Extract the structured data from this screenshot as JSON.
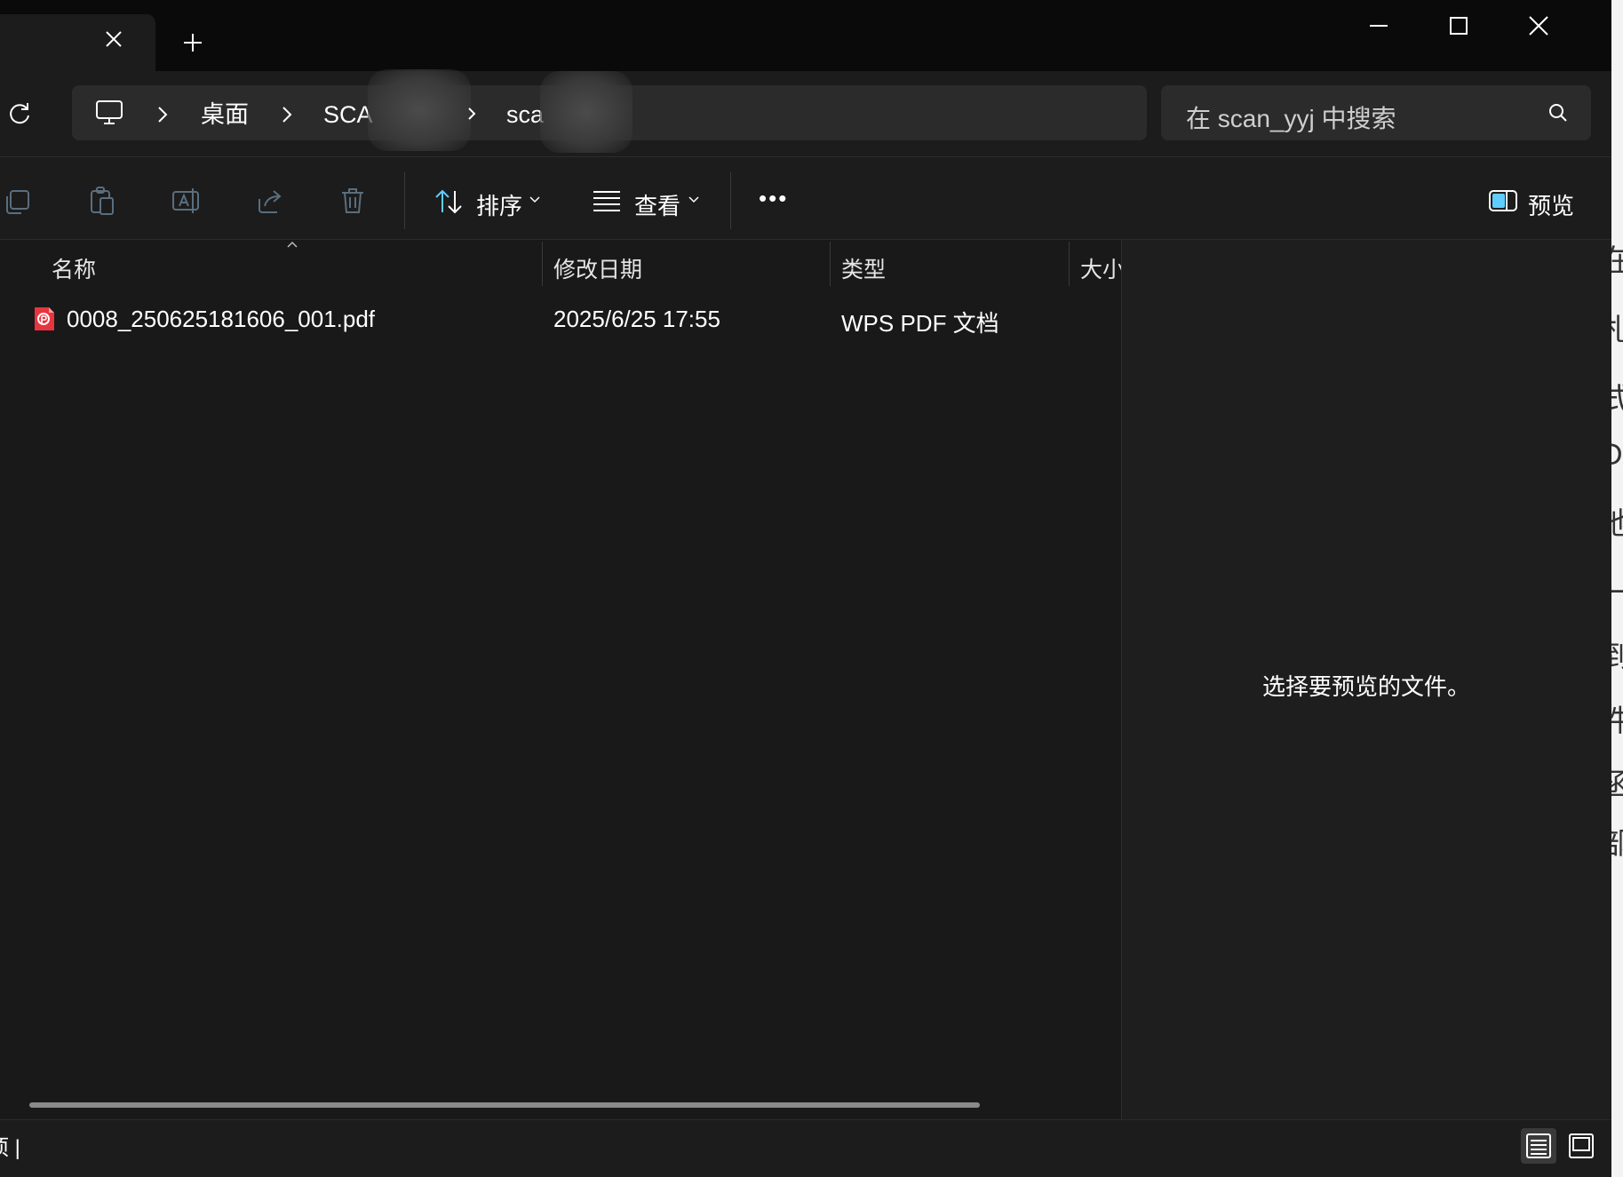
{
  "titlebar": {
    "tab_close_icon": "close-icon",
    "new_tab_icon": "plus-icon",
    "window_controls": [
      "minimize-icon",
      "maximize-icon",
      "close-icon"
    ]
  },
  "address": {
    "refresh_icon": "refresh-icon",
    "computer_icon": "computer-icon",
    "breadcrumbs": [
      "桌面",
      "SCA",
      "sca"
    ]
  },
  "search": {
    "placeholder": "在 scan_yyj 中搜索",
    "icon": "search-icon"
  },
  "toolbar": {
    "sort_label": "排序",
    "view_label": "查看",
    "more_label": "•••",
    "preview_label": "预览"
  },
  "columns": {
    "name": "名称",
    "date": "修改日期",
    "type": "类型",
    "size": "大小"
  },
  "files": [
    {
      "name": "0008_250625181606_001.pdf",
      "date": "2025/6/25 17:55",
      "type": "WPS PDF 文档",
      "size": "",
      "icon": "pdf-file-icon"
    }
  ],
  "preview_pane": {
    "message": "选择要预览的文件。"
  },
  "statusbar": {
    "text": "项 |"
  },
  "background_window": {
    "glyphs": [
      "在",
      "札",
      "式",
      "DF",
      "他",
      "一",
      "到",
      "件",
      "函",
      "部"
    ]
  },
  "colors": {
    "pdf_icon": "#e8343f",
    "accent": "#60cdff",
    "background": "#1c1c1c"
  }
}
